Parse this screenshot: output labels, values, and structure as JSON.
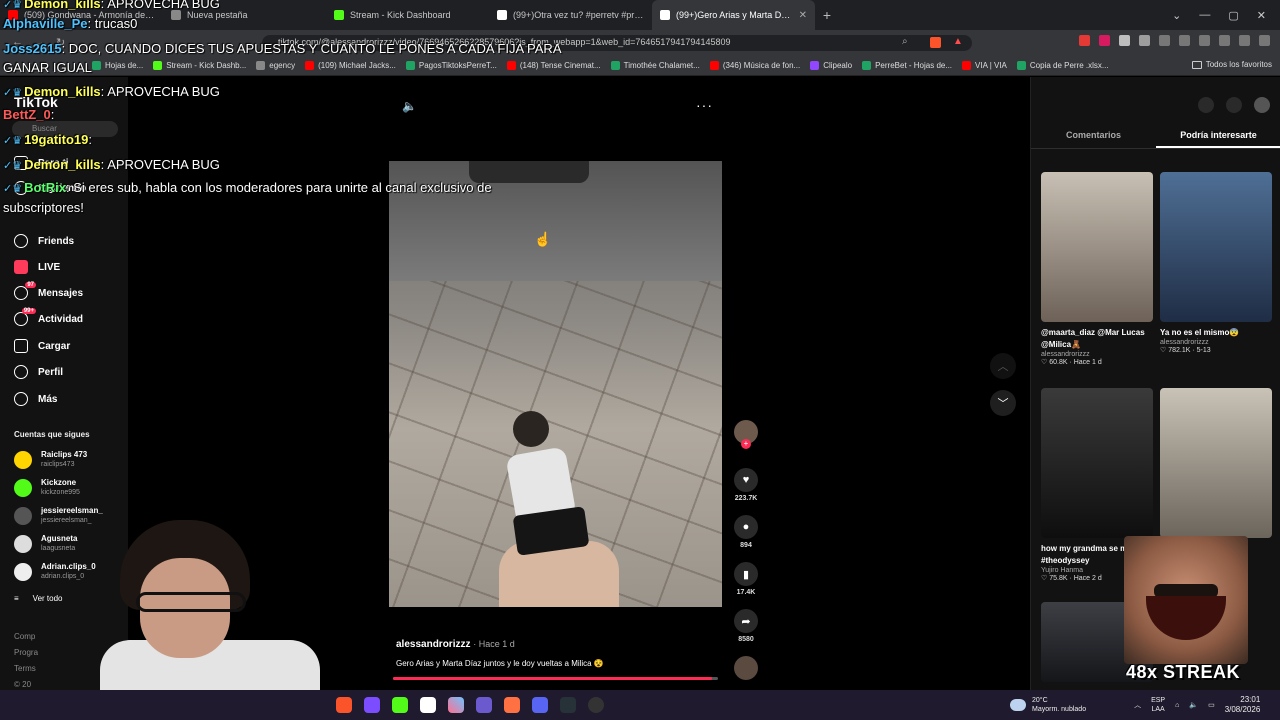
{
  "browser": {
    "tabs": [
      {
        "label": "(509) Gondwana - Armonía de amor",
        "color": "#ff0000",
        "active": false
      },
      {
        "label": "Nueva pestaña",
        "color": "#888888",
        "active": false
      },
      {
        "label": "Stream - Kick Dashboard",
        "color": "#53fc18",
        "active": false
      },
      {
        "label": "(99+)Otra vez tu? #perretv #pronosti",
        "color": "#ffffff",
        "active": false
      },
      {
        "label": "(99+)Gero Arias y Marta Díaz",
        "color": "#ffffff",
        "active": true
      }
    ],
    "new_tab": "+",
    "url": "tiktok.com/@alessandrorizzz/video/7669465266228579606?is_from_webapp=1&web_id=7646517941794145809",
    "bookmarks": [
      {
        "label": "Hojas de...",
        "color": "#1fa463"
      },
      {
        "label": "Stream - Kick Dashb...",
        "color": "#53fc18"
      },
      {
        "label": "egency",
        "color": "#888888"
      },
      {
        "label": "(109) Michael Jacks...",
        "color": "#ff0000"
      },
      {
        "label": "PagosTiktoksPerreT...",
        "color": "#1fa463"
      },
      {
        "label": "(148) Tense Cinemat...",
        "color": "#ff0000"
      },
      {
        "label": "Timothée Chalamet...",
        "color": "#1fa463"
      },
      {
        "label": "(346) Música de fon...",
        "color": "#ff0000"
      },
      {
        "label": "Clipealo",
        "color": "#9146ff"
      },
      {
        "label": "PerreBet - Hojas de...",
        "color": "#1fa463"
      },
      {
        "label": "VIA | VIA",
        "color": "#ff0000"
      },
      {
        "label": "Copia de Perre .xlsx...",
        "color": "#1fa463"
      }
    ],
    "all_bookmarks": "Todos los favoritos"
  },
  "tiktok": {
    "logo": "TikTok",
    "search_placeholder": "Buscar",
    "nav": [
      {
        "label": "Para ti",
        "icon": "home-icon",
        "badge": ""
      },
      {
        "label": "Siguiendo",
        "icon": "following-icon",
        "badge": ""
      },
      {
        "label": "Friends",
        "icon": "friends-icon",
        "badge": ""
      },
      {
        "label": "LIVE",
        "icon": "live-icon",
        "badge": ""
      },
      {
        "label": "Mensajes",
        "icon": "messages-icon",
        "badge": "97"
      },
      {
        "label": "Actividad",
        "icon": "activity-icon",
        "badge": "99+"
      },
      {
        "label": "Cargar",
        "icon": "upload-icon",
        "badge": ""
      },
      {
        "label": "Perfil",
        "icon": "profile-icon",
        "badge": ""
      },
      {
        "label": "Más",
        "icon": "more-icon",
        "badge": ""
      }
    ],
    "following_header": "Cuentas que sigues",
    "accounts": [
      {
        "name": "Raiclips 473",
        "handle": "raiclips473",
        "color": "#ffd400"
      },
      {
        "name": "Kickzone",
        "handle": "kickzone995",
        "color": "#53fc18"
      },
      {
        "name": "jessiereelsman_",
        "handle": "jessiereelsman_",
        "color": "#555555"
      },
      {
        "name": "Agusneta",
        "handle": "laagusneta",
        "color": "#dddddd"
      },
      {
        "name": "Adrian.clips_0",
        "handle": "adrian.clips_0",
        "color": "#eeeeee"
      }
    ],
    "see_all": "Ver todo",
    "footer_lines": [
      "Comp",
      "Progra",
      "Terms",
      "© 20"
    ]
  },
  "video": {
    "author": "alessandrorizzz",
    "ago": "Hace 1 d",
    "caption": "Gero Arias y Marta Díaz juntos y le doy vueltas a Milica 😵",
    "progress": 0.98,
    "likes": "223.7K",
    "comments": "894",
    "saves": "17.4K",
    "shares": "8580"
  },
  "sidebar": {
    "tabs": [
      "Comentarios",
      "Podría interesarte"
    ],
    "active_tab": 1,
    "cards": [
      {
        "title": "@maarta_diaz @Mar Lucas @Milica🧸",
        "author": "alessandrorizzz",
        "stats": "♡ 60.8K · Hace 1 d",
        "c1": "#c8c0b4",
        "c2": "#6e6258"
      },
      {
        "title": "Ya no es el mismo😨",
        "author": "alessandrorizzz",
        "stats": "♡ 782.1K · 5-13",
        "c1": "#4f6f95",
        "c2": "#1f2d45"
      },
      {
        "title": "how my grandma se me 🙈 #theodyssey",
        "author": "Yujiro Hanma",
        "stats": "♡ 75.8K · Hace 2 d",
        "c1": "#3a3a3a",
        "c2": "#0e0e0e"
      },
      {
        "title": "",
        "author": "",
        "stats": "",
        "c1": "#c9c2b6",
        "c2": "#6c655c"
      },
      {
        "title": "",
        "author": "",
        "stats": "",
        "c1": "#3d3f44",
        "c2": "#15161a"
      }
    ]
  },
  "chat": [
    {
      "user": "Demon_kills",
      "msg": "APROVECHA BUG",
      "color": "u1",
      "badges": true
    },
    {
      "user": "Alphaville_Pe",
      "msg": "trucas0",
      "color": "u2",
      "badges": false
    },
    {
      "user": "Joss2615",
      "msg": "DOC, CUANDO DICES TUS APUESTAS Y CUANTO LE PONES A CADA FIJA PARA",
      "color": "u2",
      "badges": false
    },
    {
      "user": "",
      "msg": "GANAR IGUAL",
      "color": "",
      "badges": false
    },
    {
      "user": "Demon_kills",
      "msg": "APROVECHA BUG",
      "color": "u1",
      "badges": true
    },
    {
      "user": "BettZ_0",
      "msg": "",
      "color": "u3",
      "badges": false
    },
    {
      "user": "19gatito19",
      "msg": "",
      "color": "u1",
      "badges": true
    },
    {
      "user": "Demon_kills",
      "msg": "APROVECHA BUG",
      "color": "u1",
      "badges": true
    },
    {
      "user": "BotRix",
      "msg": "Si eres sub, habla con los moderadores para unirte al canal exclusivo de",
      "color": "u4",
      "badges": true
    },
    {
      "user": "",
      "msg": "subscriptores!",
      "color": "",
      "badges": false
    }
  ],
  "overlay": {
    "streak": "48x STREAK"
  },
  "taskbar": {
    "temp": "20°C",
    "weather": "Mayorm. nublado",
    "lang1": "ESP",
    "lang2": "LAA",
    "time": "23:01",
    "date": "3/08/2026"
  }
}
